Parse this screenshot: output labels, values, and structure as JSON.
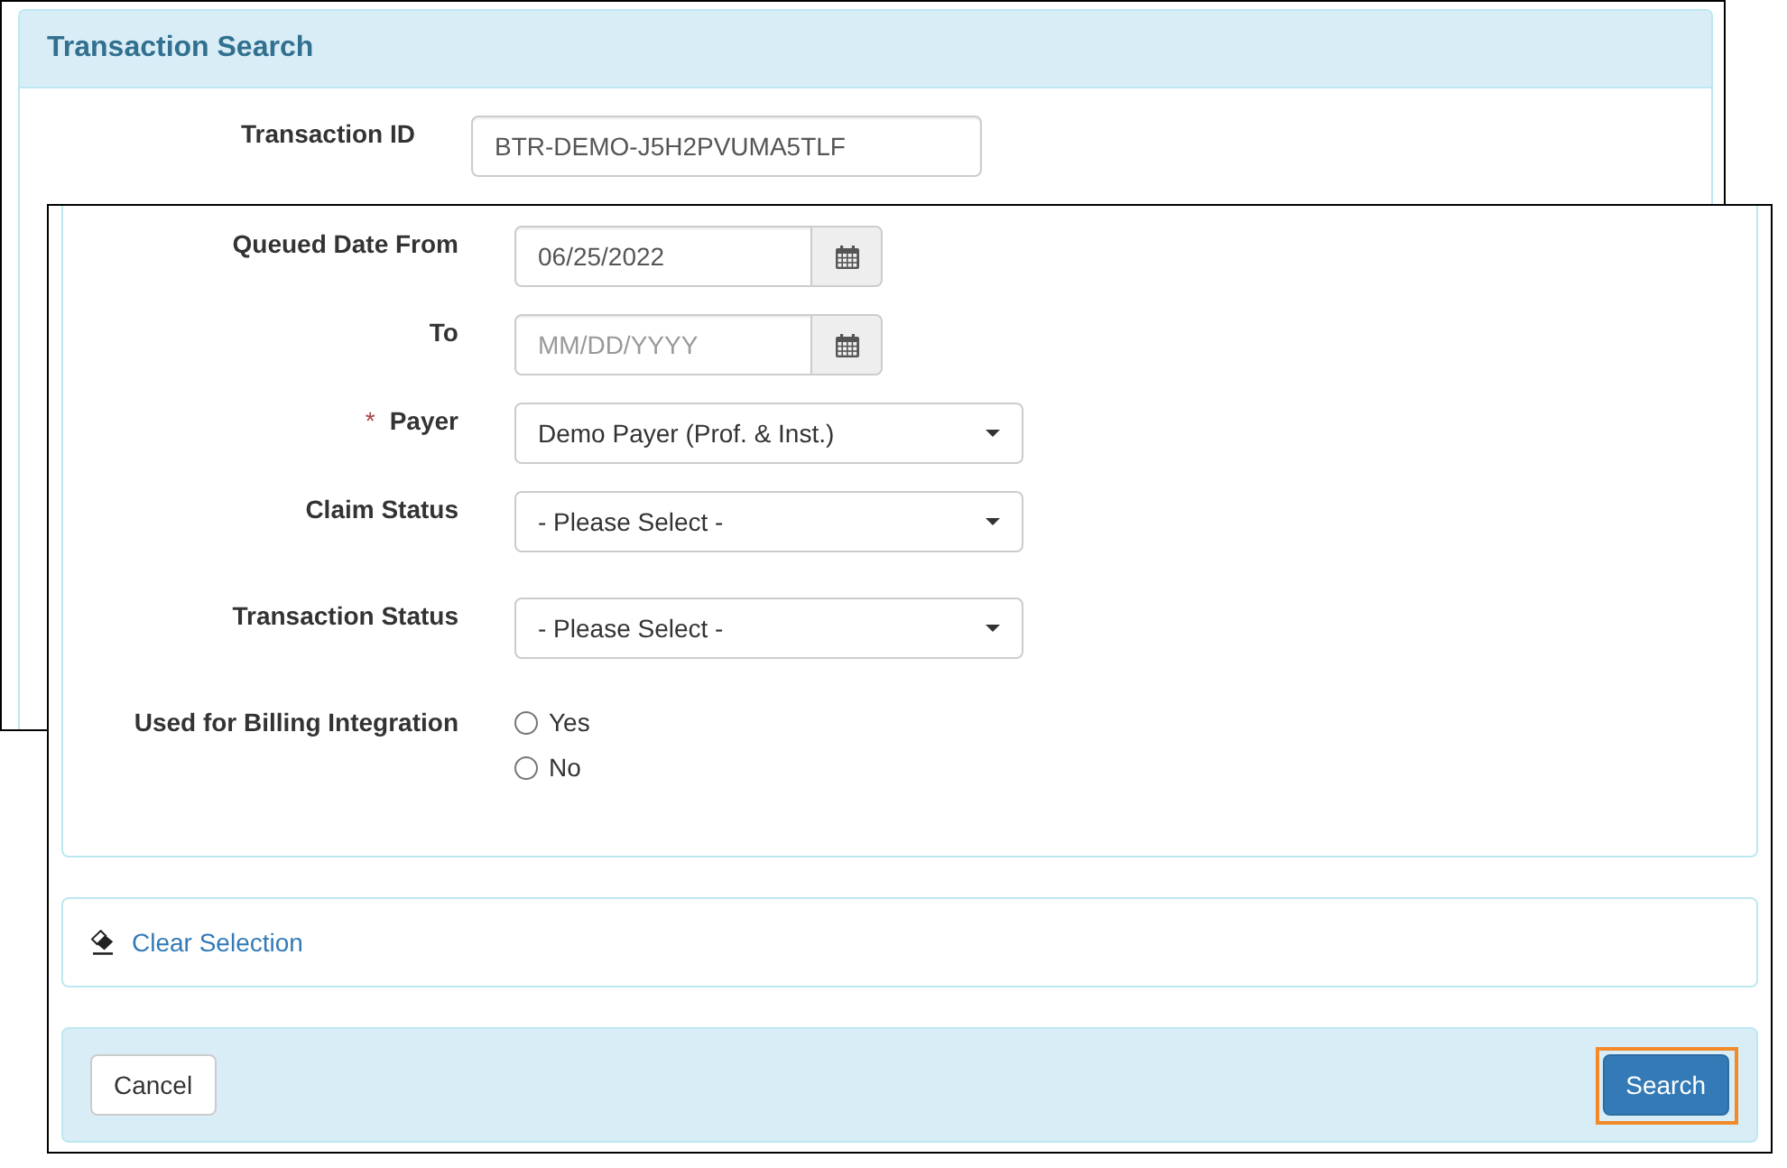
{
  "back_window": {
    "title": "Transaction Search",
    "fields": [
      {
        "kind": "text",
        "label": "Transaction ID",
        "value": "BTR-DEMO-J5H2PVUMA5TLF"
      }
    ]
  },
  "front_window": {
    "fields": [
      {
        "kind": "date",
        "label": "Queued Date From",
        "value": "06/25/2022"
      },
      {
        "kind": "date",
        "label": "To",
        "placeholder": "MM/DD/YYYY"
      },
      {
        "kind": "select",
        "label": "Payer",
        "required_mark": "*",
        "value": "Demo Payer (Prof. & Inst.)"
      },
      {
        "kind": "select",
        "label": "Claim Status",
        "value": "- Please Select -"
      },
      {
        "kind": "select",
        "label": "Transaction Status",
        "value": "- Please Select -"
      },
      {
        "kind": "radio",
        "label": "Used for Billing Integration",
        "options": [
          {
            "label": "Yes",
            "selected": false
          },
          {
            "label": "No",
            "selected": false
          }
        ]
      }
    ],
    "clear_link": {
      "label": "Clear Selection"
    },
    "buttons": [
      {
        "kind": "default",
        "label": "Cancel",
        "highlighted": false
      },
      {
        "kind": "primary",
        "label": "Search",
        "highlighted": true
      }
    ]
  }
}
